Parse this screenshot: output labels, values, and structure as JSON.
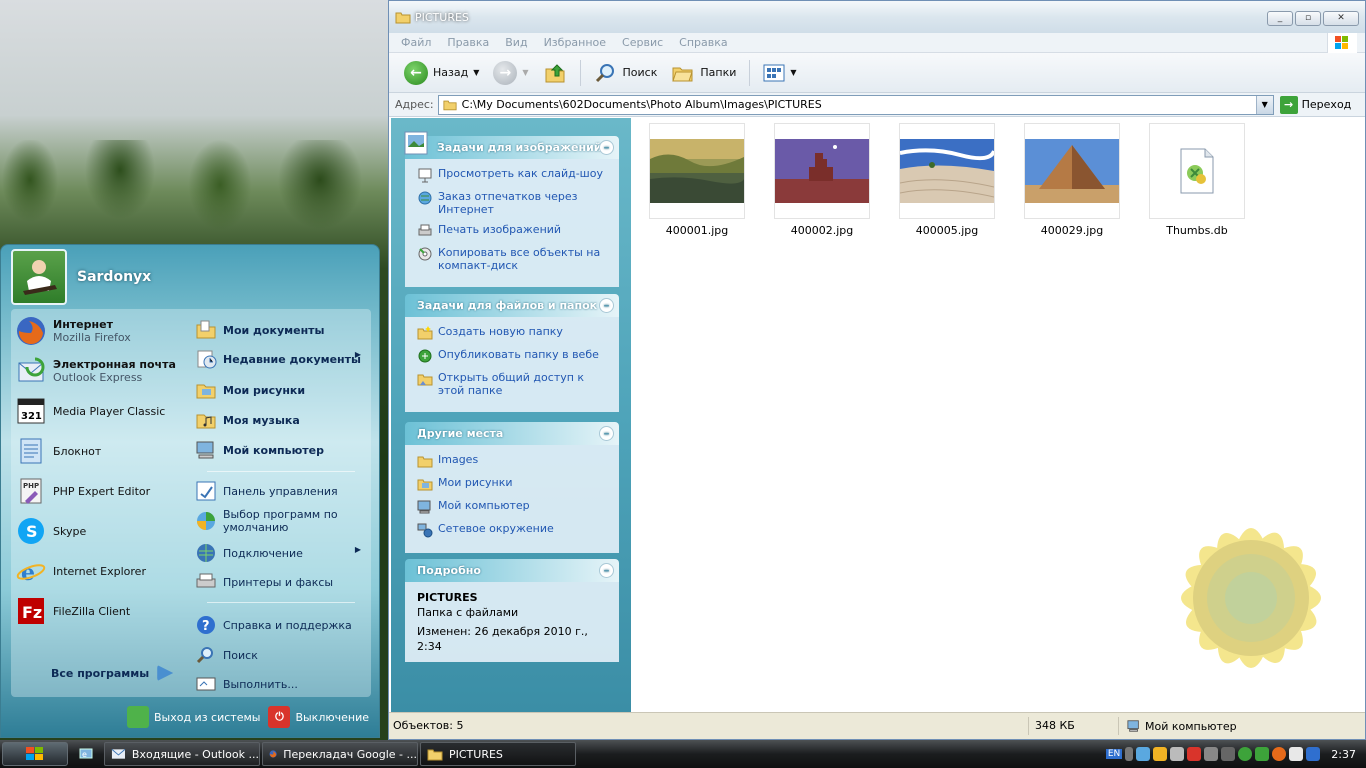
{
  "window": {
    "title": "PICTURES",
    "buttons": {
      "minimize": "0",
      "maximize": "1",
      "close": "r"
    }
  },
  "menu": [
    "Файл",
    "Правка",
    "Вид",
    "Избранное",
    "Сервис",
    "Справка"
  ],
  "toolbar": {
    "back": "Назад",
    "search": "Поиск",
    "folders": "Папки"
  },
  "address": {
    "label": "Адрес:",
    "path": "C:\\My Documents\\602Documents\\Photo Album\\Images\\PICTURES",
    "go": "Переход"
  },
  "tasks": {
    "image_tasks": {
      "title": "Задачи для изображений",
      "items": [
        "Просмотреть как слайд-шоу",
        "Заказ отпечатков через Интернет",
        "Печать изображений",
        "Копировать все объекты на компакт-диск"
      ]
    },
    "file_tasks": {
      "title": "Задачи для файлов и папок",
      "items": [
        "Создать новую папку",
        "Опубликовать папку в вебе",
        "Открыть общий доступ к этой папке"
      ]
    },
    "other_places": {
      "title": "Другие места",
      "items": [
        "Images",
        "Мои рисунки",
        "Мой компьютер",
        "Сетевое окружение"
      ]
    },
    "details": {
      "title": "Подробно",
      "name": "PICTURES",
      "type": "Папка с файлами",
      "modified": "Изменен: 26 декабря 2010 г., 2:34"
    }
  },
  "files": [
    {
      "name": "400001.jpg",
      "kind": "lake"
    },
    {
      "name": "400002.jpg",
      "kind": "rock"
    },
    {
      "name": "400005.jpg",
      "kind": "dunes"
    },
    {
      "name": "400029.jpg",
      "kind": "pyramid"
    },
    {
      "name": "Thumbs.db",
      "kind": "db"
    }
  ],
  "status": {
    "objects": "Объектов: 5",
    "size": "348 КБ",
    "location": "Мой компьютер"
  },
  "start_menu": {
    "user": "Sardonyx",
    "left": [
      {
        "name": "Интернет",
        "sub": "Mozilla Firefox"
      },
      {
        "name": "Электронная почта",
        "sub": "Outlook Express"
      },
      {
        "name": "Media Player Classic"
      },
      {
        "name": "Блокнот"
      },
      {
        "name": "PHP Expert Editor"
      },
      {
        "name": "Skype"
      },
      {
        "name": "Internet Explorer"
      },
      {
        "name": "FileZilla Client"
      }
    ],
    "all_programs": "Все программы",
    "right": [
      "Мои документы",
      "Недавние документы",
      "Мои рисунки",
      "Моя музыка",
      "Мой компьютер",
      "Панель управления",
      "Выбор программ по умолчанию",
      "Подключение",
      "Принтеры и факсы",
      "Справка и поддержка",
      "Поиск",
      "Выполнить..."
    ],
    "logoff": "Выход из системы",
    "shutdown": "Выключение"
  },
  "taskbar": {
    "tasks": [
      "Входящие - Outlook ...",
      "Перекладач Google - ...",
      "PICTURES"
    ],
    "lang": "EN",
    "clock": "2:37"
  },
  "colors": {
    "link": "#2157b2",
    "taskpane": "#4fa4ba",
    "taskbar": "#1b1d1f"
  }
}
